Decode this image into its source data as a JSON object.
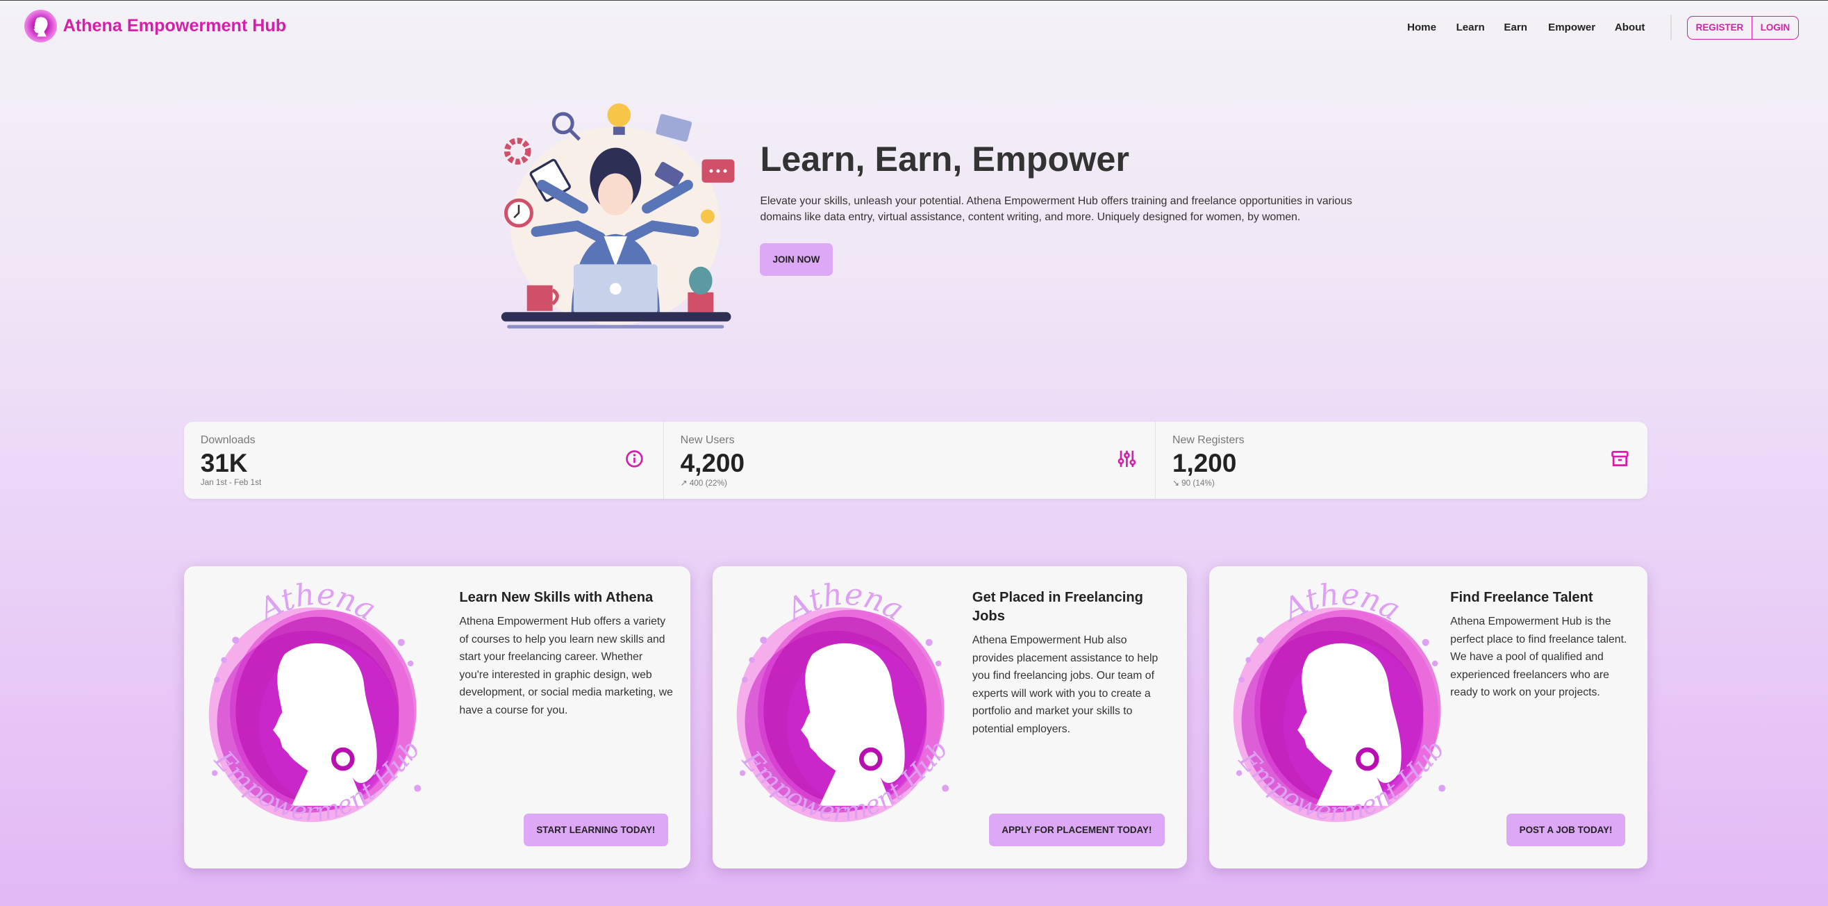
{
  "brand": {
    "title": "Athena Empowerment Hub"
  },
  "nav": {
    "items": [
      "Home",
      "Learn",
      "Earn",
      "Empower",
      "About"
    ],
    "register": "REGISTER",
    "login": "LOGIN"
  },
  "hero": {
    "heading": "Learn, Earn, Empower",
    "text": "Elevate your skills, unleash your potential. Athena Empowerment Hub offers training and freelance opportunities in various domains like data entry, virtual assistance, content writing, and more. Uniquely designed for women, by women.",
    "cta": "JOIN NOW"
  },
  "stats": [
    {
      "label": "Downloads",
      "value": "31K",
      "sub": "Jan 1st - Feb 1st",
      "icon": "info-circle-icon"
    },
    {
      "label": "New Users",
      "value": "4,200",
      "sub": "↗ 400 (22%)",
      "icon": "sliders-icon"
    },
    {
      "label": "New Registers",
      "value": "1,200",
      "sub": "↘ 90 (14%)",
      "icon": "archive-icon"
    }
  ],
  "cards": [
    {
      "title": "Learn New Skills with Athena",
      "body": "Athena Empowerment Hub offers a variety of courses to help you learn new skills and start your freelancing career. Whether you're interested in graphic design, web development, or social media marketing, we have a course for you.",
      "button": "START LEARNING TODAY!"
    },
    {
      "title": "Get Placed in Freelancing Jobs",
      "body": "Athena Empowerment Hub also provides placement assistance to help you find freelancing jobs. Our team of experts will work with you to create a portfolio and market your skills to potential employers.",
      "button": "APPLY FOR PLACEMENT TODAY!"
    },
    {
      "title": "Find Freelance Talent",
      "body": "Athena Empowerment Hub is the perfect place to find freelance talent. We have a pool of qualified and experienced freelancers who are ready to work on your projects.",
      "button": "POST A JOB TODAY!"
    }
  ],
  "logo_text": {
    "top": "Athena",
    "bottom": "Empowerment Hub"
  },
  "colors": {
    "brand": "#d41fa8",
    "button": "#dda8f5",
    "logo_text": "#dda0f2"
  }
}
